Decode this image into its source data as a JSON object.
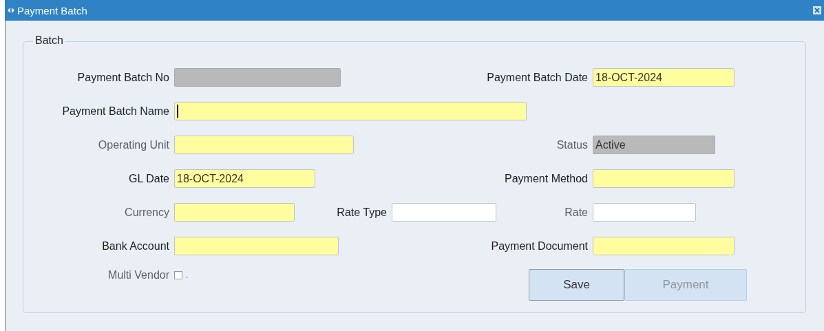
{
  "window": {
    "title": "Payment Batch"
  },
  "group": {
    "legend": "Batch"
  },
  "rows": [
    {
      "left": {
        "label": "Payment Batch No",
        "label_dimmed": false,
        "kind": "readonly"
      },
      "right": {
        "label": "Payment Batch Date",
        "label_dimmed": false,
        "kind": "required",
        "value": "18-OCT-2024"
      }
    },
    {
      "left": {
        "label": "Payment Batch Name",
        "label_dimmed": false,
        "kind": "required",
        "focused": true
      }
    },
    {
      "left": {
        "label": "Operating Unit",
        "label_dimmed": true,
        "kind": "required"
      },
      "right": {
        "label": "Status",
        "label_dimmed": true,
        "kind": "readonly",
        "value": "Active"
      }
    },
    {
      "left": {
        "label": "GL Date",
        "label_dimmed": false,
        "kind": "required",
        "value": "18-OCT-2024"
      },
      "right": {
        "label": "Payment Method",
        "label_dimmed": false,
        "kind": "required"
      }
    },
    {
      "left": {
        "label": "Currency",
        "label_dimmed": true,
        "kind": "required"
      },
      "middle": {
        "label": "Rate Type",
        "label_dimmed": false,
        "kind": "optional"
      },
      "right": {
        "label": "Rate",
        "label_dimmed": true,
        "kind": "optional"
      }
    },
    {
      "left": {
        "label": "Bank Account",
        "label_dimmed": false,
        "kind": "required"
      },
      "right": {
        "label": "Payment Document",
        "label_dimmed": false,
        "kind": "required"
      }
    }
  ],
  "multi_vendor": {
    "label": "Multi Vendor",
    "label_dimmed": true,
    "checked": false,
    "suffix": "."
  },
  "buttons": [
    {
      "label": "Save",
      "disabled": false
    },
    {
      "label": "Payment",
      "disabled": true
    }
  ]
}
